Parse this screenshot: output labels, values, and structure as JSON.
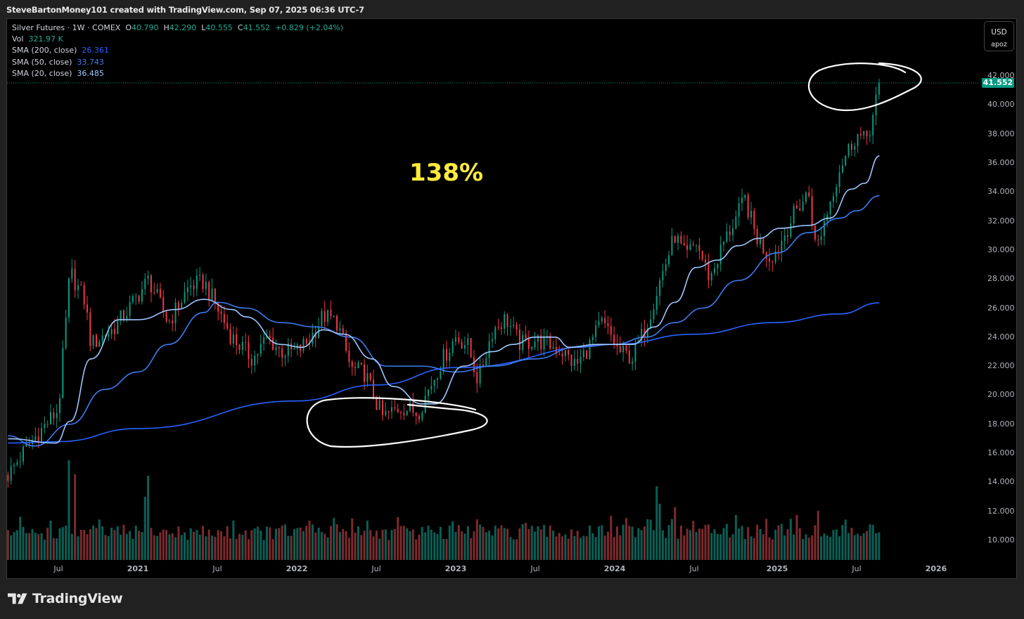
{
  "caption": "SteveBartonMoney101 created with TradingView.com, Sep 07, 2025 06:36 UTC-7",
  "legend": {
    "symbol": "Silver Futures · 1W · COMEX",
    "open_label": "O",
    "open": "40.790",
    "high_label": "H",
    "high": "42.290",
    "low_label": "L",
    "low": "40.555",
    "close_label": "C",
    "close": "41.552",
    "change": "+0.829 (+2.04%)",
    "vol_label": "Vol",
    "vol": "321.97 K",
    "sma200_label": "SMA (200, close)",
    "sma200": "26.361",
    "sma50_label": "SMA (50, close)",
    "sma50": "33.743",
    "sma20_label": "SMA (20, close)",
    "sma20": "36.485"
  },
  "unit": {
    "currency": "USD",
    "unit": "apoz"
  },
  "annotation": "138%",
  "brand": "TradingView",
  "colors": {
    "up": "#089981",
    "down": "#f23645",
    "vol_up": "#0b5f55",
    "vol_down": "#7d2a2d",
    "sma200": "#2962ff",
    "sma50": "#3d7bf0",
    "sma20": "#9ec7ff",
    "annotation": "#ffeb3b",
    "background": "#000000"
  },
  "chart_data": {
    "type": "candlestick",
    "interval": "1W",
    "last_price": "41.552",
    "ylim": [
      9,
      43
    ],
    "y_ticks": [
      "42.000",
      "40.000",
      "38.000",
      "36.000",
      "34.000",
      "32.000",
      "30.000",
      "28.000",
      "26.000",
      "24.000",
      "22.000",
      "20.000",
      "18.000",
      "16.000",
      "14.000",
      "12.000",
      "10.000"
    ],
    "x_ticks": [
      "Jul",
      "2021",
      "Jul",
      "2022",
      "Jul",
      "2023",
      "Jul",
      "2024",
      "Jul",
      "2025",
      "Jul",
      "2026"
    ],
    "price_path": [
      [
        "2020-03-07",
        14.5
      ],
      [
        "2020-04-22",
        16.5
      ],
      [
        "2020-07-01",
        19.0
      ],
      [
        "2020-07-28",
        28.5
      ],
      [
        "2020-09-01",
        26.5
      ],
      [
        "2020-09-15",
        23.5
      ],
      [
        "2020-11-03",
        24.5
      ],
      [
        "2020-12-12",
        26.0
      ],
      [
        "2021-01-26",
        28.0
      ],
      [
        "2021-03-10",
        25.0
      ],
      [
        "2021-04-28",
        27.5
      ],
      [
        "2021-06-01",
        27.8
      ],
      [
        "2021-07-01",
        26.0
      ],
      [
        "2021-08-04",
        24.0
      ],
      [
        "2021-09-22",
        22.5
      ],
      [
        "2021-10-25",
        24.0
      ],
      [
        "2021-11-25",
        23.0
      ],
      [
        "2022-01-01",
        23.0
      ],
      [
        "2022-01-30",
        23.8
      ],
      [
        "2022-03-01",
        25.5
      ],
      [
        "2022-04-03",
        25.0
      ],
      [
        "2022-05-04",
        21.8
      ],
      [
        "2022-06-06",
        21.5
      ],
      [
        "2022-07-01",
        19.5
      ],
      [
        "2022-07-16",
        18.5
      ],
      [
        "2022-08-28",
        19.2
      ],
      [
        "2022-10-06",
        18.8
      ],
      [
        "2022-11-01",
        20.5
      ],
      [
        "2022-12-02",
        22.5
      ],
      [
        "2023-01-01",
        24.0
      ],
      [
        "2023-01-28",
        23.5
      ],
      [
        "2023-02-22",
        21.0
      ],
      [
        "2023-03-25",
        24.5
      ],
      [
        "2023-04-25",
        25.3
      ],
      [
        "2023-05-28",
        23.5
      ],
      [
        "2023-07-01",
        23.8
      ],
      [
        "2023-08-01",
        23.5
      ],
      [
        "2023-09-03",
        23.0
      ],
      [
        "2023-10-04",
        22.0
      ],
      [
        "2023-11-06",
        23.5
      ],
      [
        "2023-12-01",
        25.0
      ],
      [
        "2023-12-25",
        24.0
      ],
      [
        "2024-01-10",
        23.0
      ],
      [
        "2024-02-12",
        22.6
      ],
      [
        "2024-03-13",
        24.8
      ],
      [
        "2024-04-15",
        28.0
      ],
      [
        "2024-05-18",
        31.0
      ],
      [
        "2024-06-12",
        29.5
      ],
      [
        "2024-07-06",
        30.5
      ],
      [
        "2024-08-07",
        28.0
      ],
      [
        "2024-09-08",
        30.5
      ],
      [
        "2024-10-11",
        32.5
      ],
      [
        "2024-10-27",
        33.5
      ],
      [
        "2024-11-21",
        31.0
      ],
      [
        "2024-12-22",
        29.5
      ],
      [
        "2025-01-09",
        30.0
      ],
      [
        "2025-02-18",
        32.5
      ],
      [
        "2025-03-21",
        34.0
      ],
      [
        "2025-04-07",
        30.0
      ],
      [
        "2025-05-01",
        32.5
      ],
      [
        "2025-06-02",
        35.8
      ],
      [
        "2025-07-09",
        38.0
      ],
      [
        "2025-07-28",
        37.5
      ],
      [
        "2025-08-14",
        38.8
      ],
      [
        "2025-09-01",
        41.552
      ]
    ],
    "series": [
      {
        "name": "SMA (200, close)",
        "color": "#2962ff",
        "points": [
          [
            "2020-03-07",
            16.7
          ],
          [
            "2020-07-01",
            16.8
          ],
          [
            "2021-01-01",
            17.7
          ],
          [
            "2022-01-01",
            19.6
          ],
          [
            "2022-07-01",
            20.7
          ],
          [
            "2023-01-01",
            21.9
          ],
          [
            "2024-01-01",
            23.5
          ],
          [
            "2024-07-01",
            24.2
          ],
          [
            "2025-01-01",
            25.0
          ],
          [
            "2025-06-01",
            25.6
          ],
          [
            "2025-09-01",
            26.361
          ]
        ]
      },
      {
        "name": "SMA (50, close)",
        "color": "#3d7bf0",
        "points": [
          [
            "2020-03-07",
            17.2
          ],
          [
            "2020-05-08",
            16.5
          ],
          [
            "2020-07-28",
            18.0
          ],
          [
            "2020-10-17",
            20.4
          ],
          [
            "2021-01-01",
            21.6
          ],
          [
            "2021-03-10",
            23.5
          ],
          [
            "2021-06-01",
            25.7
          ],
          [
            "2021-07-01",
            26.4
          ],
          [
            "2021-09-06",
            26.0
          ],
          [
            "2021-11-25",
            25.0
          ],
          [
            "2022-02-15",
            24.7
          ],
          [
            "2022-05-04",
            24.0
          ],
          [
            "2022-07-25",
            22.0
          ],
          [
            "2022-10-15",
            22.0
          ],
          [
            "2023-01-01",
            21.6
          ],
          [
            "2023-03-25",
            22.0
          ],
          [
            "2023-07-01",
            22.5
          ],
          [
            "2023-10-04",
            23.3
          ],
          [
            "2024-01-01",
            23.5
          ],
          [
            "2024-03-13",
            24.0
          ],
          [
            "2024-05-18",
            25.0
          ],
          [
            "2024-07-21",
            26.0
          ],
          [
            "2024-10-11",
            27.9
          ],
          [
            "2025-01-09",
            29.8
          ],
          [
            "2025-03-21",
            31.2
          ],
          [
            "2025-06-02",
            32.2
          ],
          [
            "2025-07-09",
            32.7
          ],
          [
            "2025-09-01",
            33.743
          ]
        ]
      },
      {
        "name": "SMA (20, close)",
        "color": "#9ec7ff",
        "points": [
          [
            "2020-03-07",
            17.0
          ],
          [
            "2020-06-26",
            16.7
          ],
          [
            "2020-07-28",
            18.2
          ],
          [
            "2020-09-15",
            22.5
          ],
          [
            "2020-11-18",
            25.2
          ],
          [
            "2021-01-01",
            25.2
          ],
          [
            "2021-03-27",
            25.9
          ],
          [
            "2021-06-01",
            26.6
          ],
          [
            "2021-08-04",
            25.9
          ],
          [
            "2021-09-06",
            25.4
          ],
          [
            "2021-11-25",
            23.5
          ],
          [
            "2022-01-13",
            23.3
          ],
          [
            "2022-03-01",
            24.5
          ],
          [
            "2022-04-19",
            24.2
          ],
          [
            "2022-06-22",
            22.5
          ],
          [
            "2022-08-10",
            20.6
          ],
          [
            "2022-10-15",
            19.4
          ],
          [
            "2022-11-15",
            19.4
          ],
          [
            "2023-01-19",
            22.0
          ],
          [
            "2023-03-25",
            23.0
          ],
          [
            "2023-05-12",
            23.5
          ],
          [
            "2023-07-01",
            24.0
          ],
          [
            "2023-08-16",
            24.0
          ],
          [
            "2023-09-19",
            23.3
          ],
          [
            "2023-11-22",
            23.5
          ],
          [
            "2024-02-12",
            23.5
          ],
          [
            "2024-04-01",
            24.7
          ],
          [
            "2024-05-18",
            26.4
          ],
          [
            "2024-07-06",
            28.8
          ],
          [
            "2024-08-24",
            29.3
          ],
          [
            "2024-10-11",
            30.3
          ],
          [
            "2024-11-28",
            30.8
          ],
          [
            "2025-01-16",
            31.5
          ],
          [
            "2025-03-21",
            31.7
          ],
          [
            "2025-05-09",
            32.2
          ],
          [
            "2025-06-28",
            34.2
          ],
          [
            "2025-07-28",
            34.6
          ],
          [
            "2025-09-01",
            36.485
          ]
        ]
      }
    ]
  }
}
